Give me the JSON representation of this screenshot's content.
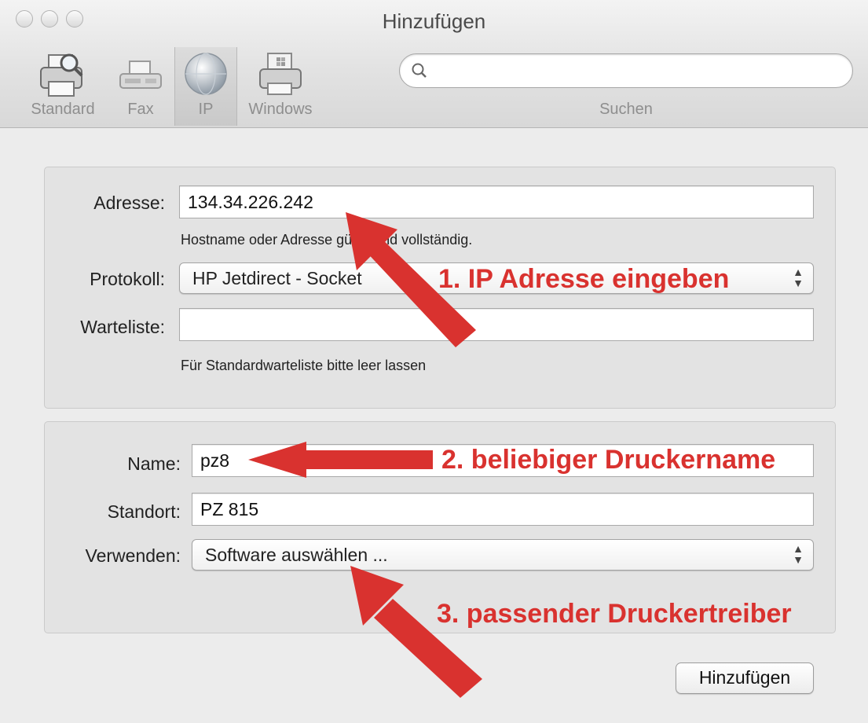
{
  "window": {
    "title": "Hinzufügen"
  },
  "toolbar": {
    "items": [
      {
        "label": "Standard",
        "icon": "printer-magnifier-icon"
      },
      {
        "label": "Fax",
        "icon": "fax-icon"
      },
      {
        "label": "IP",
        "icon": "globe-icon",
        "selected": true
      },
      {
        "label": "Windows",
        "icon": "windows-printer-icon"
      }
    ],
    "search": {
      "label": "Suchen",
      "placeholder": "",
      "icon": "search-icon"
    }
  },
  "form": {
    "address": {
      "label": "Adresse:",
      "value": "134.34.226.242",
      "hint": "Hostname oder Adresse gültig und vollständig."
    },
    "protocol": {
      "label": "Protokoll:",
      "value": "HP Jetdirect - Socket"
    },
    "queue": {
      "label": "Warteliste:",
      "value": "",
      "hint": "Für Standardwarteliste bitte leer lassen"
    },
    "name": {
      "label": "Name:",
      "value": "pz8"
    },
    "location": {
      "label": "Standort:",
      "value": "PZ 815"
    },
    "use": {
      "label": "Verwenden:",
      "value": "Software auswählen ..."
    }
  },
  "buttons": {
    "add": "Hinzufügen"
  },
  "annotations": {
    "step1": "1. IP Adresse eingeben",
    "step2": "2. beliebiger Druckername",
    "step3": "3. passender Druckertreiber",
    "color": "#d9322f"
  }
}
